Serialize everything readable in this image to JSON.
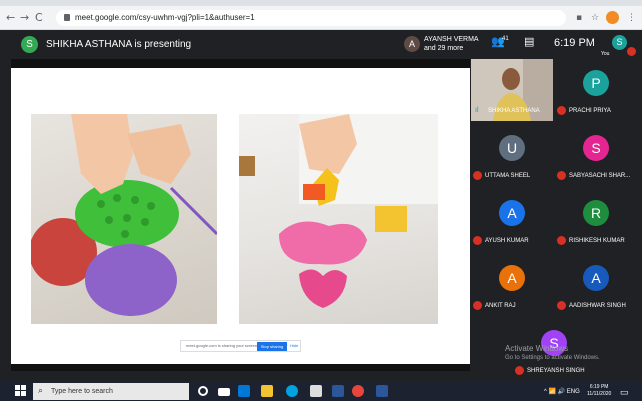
{
  "browser": {
    "back": "←",
    "forward": "→",
    "reload": "C",
    "url": "meet.google.com/csy-uwhm-vgj?pli=1&authuser=1",
    "icons": [
      "cast-icon",
      "star-icon",
      "extension-icon",
      "menu-icon"
    ]
  },
  "meet": {
    "presenter_initial": "S",
    "presenter_text": "SHIKHA ASTHANA is presenting",
    "attendees_initial": "A",
    "attendees_line1": "AYANSH VERMA",
    "attendees_line2": "and 29 more",
    "people_count": "41",
    "time": "6:19 PM",
    "self_initial": "S",
    "self_label": "You"
  },
  "share_bar": {
    "text": "meet.google.com is sharing your screen.",
    "stop_label": "Stop sharing",
    "hide_label": "Hide"
  },
  "participants": [
    {
      "name": "SHIKHA ASTHANA",
      "video": true
    },
    {
      "name": "PRACHI PRIYA",
      "initial": "P",
      "color": "#1ba29c"
    },
    {
      "name": "UTTAMA SHEEL",
      "initial": "U",
      "color": "#5f6f80"
    },
    {
      "name": "SABYASACHI SHAR...",
      "initial": "S",
      "color": "#e52592"
    },
    {
      "name": "AYUSH KUMAR",
      "initial": "A",
      "color": "#1a73e8"
    },
    {
      "name": "RISHIKESH KUMAR",
      "initial": "R",
      "color": "#1e8e3e"
    },
    {
      "name": "ANKIT RAJ",
      "initial": "A",
      "color": "#e8710a"
    },
    {
      "name": "AADISHWAR SINGH",
      "initial": "A",
      "color": "#185abc"
    },
    {
      "name": "SHREYANSH SINGH",
      "initial": "S",
      "color": "#a142f4"
    }
  ],
  "watermark": {
    "line1": "Activate Windows",
    "line2": "Go to Settings to activate Windows."
  },
  "taskbar": {
    "search_placeholder": "Type here to search",
    "time": "6:19 PM",
    "date": "11/11/2020",
    "tray": "^ 📶 🔊 ENG"
  }
}
